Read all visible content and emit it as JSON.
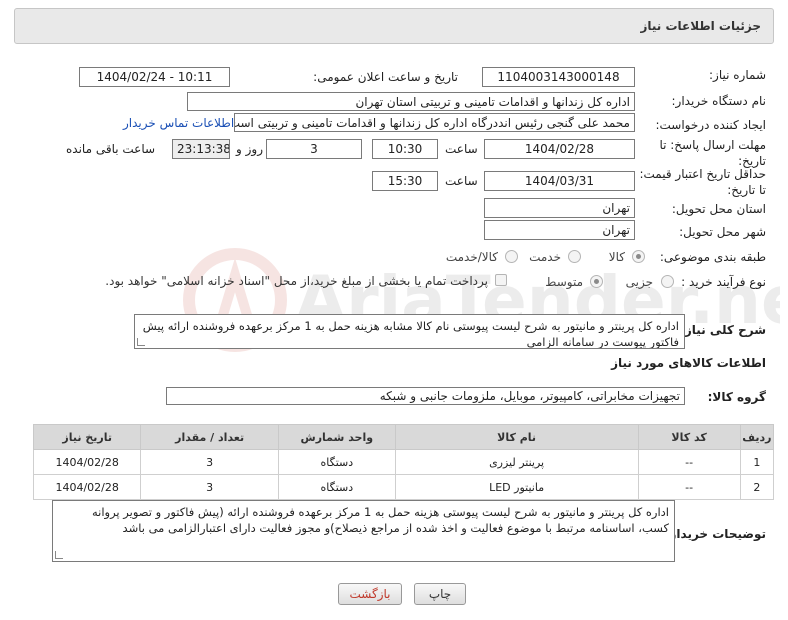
{
  "header": {
    "title": "جزئیات اطلاعات نیاز"
  },
  "form": {
    "need_number_label": "شماره نیاز:",
    "need_number": "1104003143000148",
    "announce_label": "تاریخ و ساعت اعلان عمومی:",
    "announce_value": "1404/02/24 - 10:11",
    "buyer_org_label": "نام دستگاه خریدار:",
    "buyer_org": "اداره کل زندانها و اقدامات تامینی و تربیتی استان تهران",
    "creator_label": "ایجاد کننده درخواست:",
    "creator": "محمد علی گنجی رئیس انددرگاه  اداره کل زندانها و اقدامات تامینی و تربیتی است",
    "contact_link": "اطلاعات تماس خریدار",
    "deadline_label": "مهلت ارسال پاسخ: تا تاریخ:",
    "deadline_date": "1404/02/28",
    "time_label": "ساعت",
    "deadline_time": "10:30",
    "days_value": "3",
    "days_label": "روز و",
    "remaining_time": "23:13:38",
    "remaining_label": "ساعت باقی مانده",
    "price_validity_label": "حداقل تاریخ اعتبار قیمت: تا تاریخ:",
    "price_validity_date": "1404/03/31",
    "price_validity_time": "15:30",
    "province_label": "استان محل تحویل:",
    "province": "تهران",
    "city_label": "شهر محل تحویل:",
    "city": "تهران",
    "category_label": "طبقه بندی موضوعی:",
    "category_options": [
      "کالا",
      "خدمت",
      "کالا/خدمت"
    ],
    "process_label": "نوع فرآیند خرید :",
    "process_options": [
      "جزیی",
      "متوسط"
    ],
    "payment_note": "پرداخت تمام یا بخشی از مبلغ خرید،از محل \"اسناد خزانه اسلامی\" خواهد بود."
  },
  "description": {
    "label": "شرح کلی نیاز:",
    "text": "اداره کل پرینتر و مانیتور  به شرح لیست پیوستی نام کالا مشابه هزینه حمل به 1 مرکز برعهده فروشنده ارائه پیش فاکتور پیوست در سامانه الزامی"
  },
  "goods": {
    "section_title": "اطلاعات کالاهای مورد نیاز",
    "group_label": "گروه کالا:",
    "group_value": "تجهیزات مخابراتی، کامپیوتر، موبایل، ملزومات جانبی و شبکه",
    "columns": [
      "ردیف",
      "کد کالا",
      "نام کالا",
      "واحد شمارش",
      "تعداد / مقدار",
      "تاریخ نیاز"
    ],
    "rows": [
      [
        "1",
        "--",
        "پرینتر لیزری",
        "دستگاه",
        "3",
        "1404/02/28"
      ],
      [
        "2",
        "--",
        "مانیتور LED",
        "دستگاه",
        "3",
        "1404/02/28"
      ]
    ]
  },
  "buyer_notes": {
    "label": "توضیحات خریدار:",
    "text": "اداره کل پرینتر و مانیتور به شرح لیست پیوستی  هزینه حمل به 1 مرکز برعهده فروشنده ارائه (پیش فاکتور و  تصویر پروانه کسب، اساسنامه مرتبط با موضوع فعالیت و اخذ شده از مراجع ذیصلاح)و مجوز فعالیت دارای اعتبارالزامی می باشد"
  },
  "buttons": {
    "print": "چاپ",
    "back": "بازگشت"
  },
  "watermark": {
    "text": "AriaTender.neT"
  }
}
